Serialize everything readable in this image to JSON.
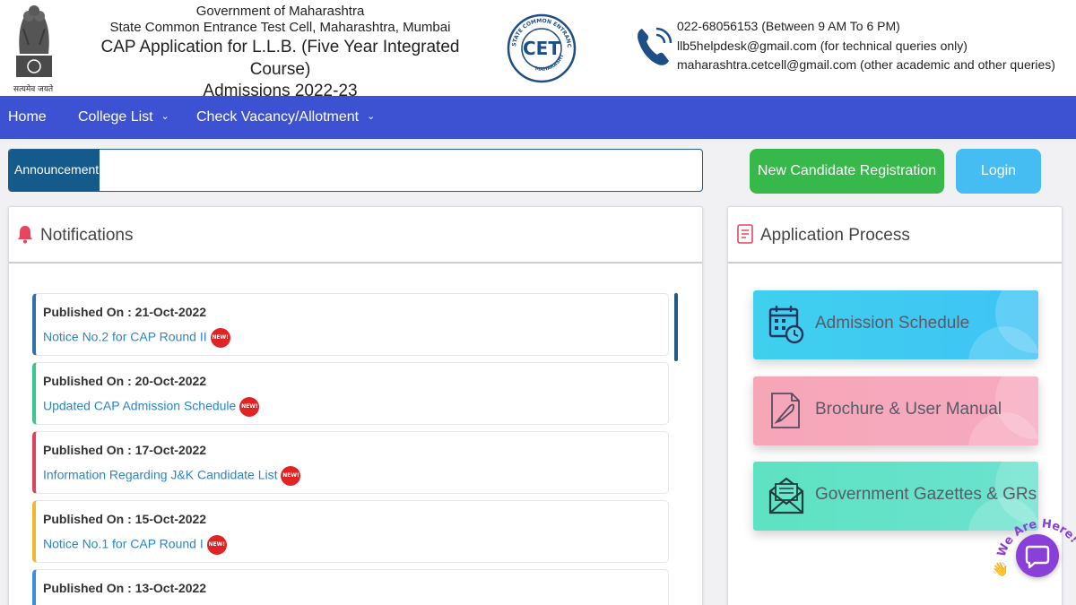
{
  "header": {
    "emblem_motto": "सत्यमेव जयते",
    "org_line1": "Government of Maharashtra",
    "org_line2": "State Common Entrance Test Cell, Maharashtra, Mumbai",
    "org_line3": "CAP Application for L.L.B. (Five Year Integrated Course)",
    "org_line4": "Admissions 2022-23",
    "cet_logo": {
      "center": "CET",
      "ring_top": "STATE COMMON ENTRANCE TEST CELL",
      "ring_bottom": "MAHARASHTRA"
    },
    "contacts": [
      "022-68056153 (Between 9 AM To 6 PM)",
      "llb5helpdesk@gmail.com (for technical queries only)",
      "maharashtra.cetcell@gmail.com (other academic and other queries)"
    ]
  },
  "nav": {
    "home": "Home",
    "college_list": "College List",
    "check_vacancy": "Check Vacancy/Allotment"
  },
  "announcement": {
    "label": "Announcement",
    "text": ""
  },
  "buttons": {
    "register": "New Candidate Registration",
    "login": "Login"
  },
  "notifications": {
    "title": "Notifications",
    "badge_text": "NEW!",
    "items": [
      {
        "published": "Published On : 21-Oct-2022",
        "link": "Notice No.2 for CAP Round II",
        "color": "#2f6fb0"
      },
      {
        "published": "Published On : 20-Oct-2022",
        "link": "Updated CAP Admission Schedule",
        "color": "#36c98e"
      },
      {
        "published": "Published On : 17-Oct-2022",
        "link": "Information Regarding J&K Candidate List",
        "color": "#e0405a"
      },
      {
        "published": "Published On : 15-Oct-2022",
        "link": "Notice No.1 for CAP Round I",
        "color": "#f2b630"
      },
      {
        "published": "Published On : 13-Oct-2022",
        "link": "",
        "color": "#3a8fd9"
      }
    ]
  },
  "application": {
    "title": "Application Process",
    "cards": [
      {
        "label": "Admission Schedule",
        "icon": "calendar-clock-icon"
      },
      {
        "label": "Brochure & User Manual",
        "icon": "rocket-document-icon"
      },
      {
        "label": "Government Gazettes & GRs",
        "icon": "envelope-letter-icon"
      }
    ]
  },
  "chat": {
    "label": "We Are Here!",
    "color": "#8b3fd9"
  },
  "colors": {
    "navbar": "#3d51d3",
    "register": "#36b84a",
    "login": "#45bdf2",
    "announcement_tag": "#145a8a"
  }
}
